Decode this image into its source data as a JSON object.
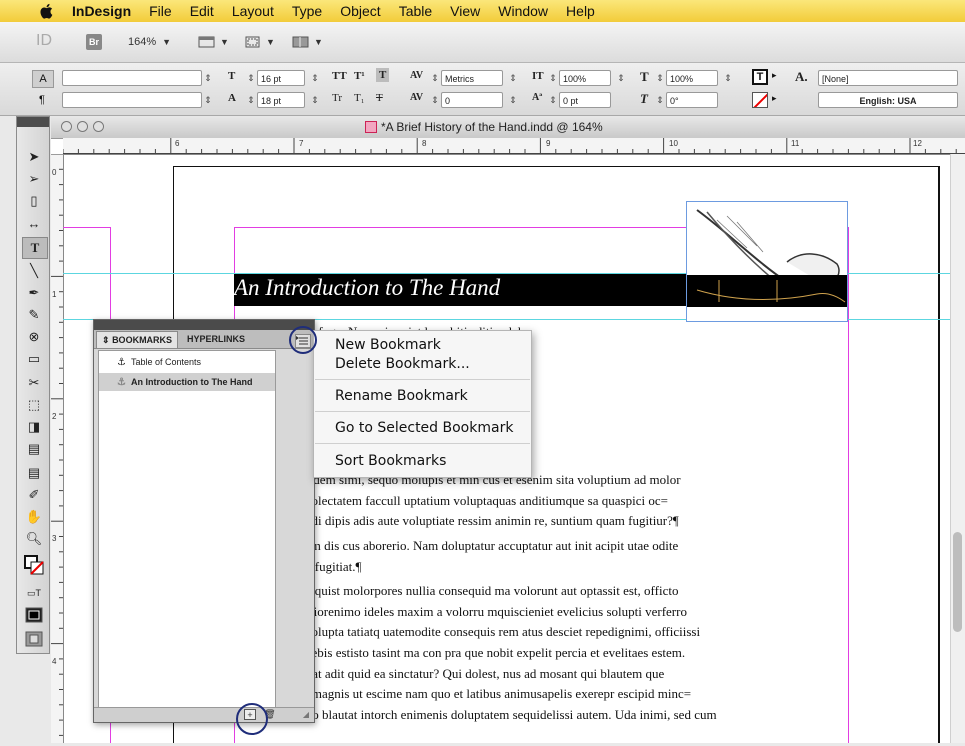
{
  "menubar": {
    "app": "InDesign",
    "items": [
      "File",
      "Edit",
      "Layout",
      "Type",
      "Object",
      "Table",
      "View",
      "Window",
      "Help"
    ]
  },
  "appbar": {
    "logo": "ID",
    "bridge": "Br",
    "zoom": "164%"
  },
  "control": {
    "font_size": "16 pt",
    "leading": "18 pt",
    "kerning": "Metrics",
    "tracking": "0",
    "vscale": "100%",
    "hscale": "100%",
    "baseline": "0 pt",
    "skew": "0°",
    "char_style": "[None]",
    "language": "English: USA",
    "case_buttons": [
      "TT",
      "T¹",
      "T",
      "Tr",
      "T₁",
      "T"
    ]
  },
  "document": {
    "title": "*A Brief History of the Hand.indd @ 164%",
    "ruler_h": [
      "6",
      "7",
      "8",
      "9",
      "10",
      "11",
      "12"
    ],
    "ruler_v": [
      "0",
      "1",
      "2",
      "3",
      "4"
    ],
    "heading": "An Introduction to The Hand",
    "body_lines": [
      "m fuga. Nam, sim niet la nobitis ditiandel",
      "simus delende niscia vitat que nobita que",
      "et ea ipsaecuptur autem aut ipsam aut ea",
      "um niminimpor alia aut labori cus, occum",
      "nentum hicius ut omni alitae si alic tore",
      "nis ad entibustrum ressunt, eum nonseque",
      "r re est, aditatur?¶",
      "s dem simi, sequo molupis et min cus et esenim sita voluptium ad molor",
      " dolectatem faccull uptatium voluptaquas anditiumque sa quaspici oc=",
      " odi dipis adis aute voluptiate ressim animin re, suntium quam fugitiur?¶",
      "em dis cus aborerio. Nam doluptatur accuptatur aut init acipit utae odite",
      "n fugitiat.¶",
      "d quist molorpores nullia consequid ma volorunt aut optassit est, officto",
      "stiorenimo ideles maxim a volorru mquiscieniet evelicius solupti verferro",
      "volupta tatiatq uatemodite consequis rem atus desciet repedignimi, officiissi",
      "debis estisto tasint ma con pra que nobit expelit percia et evelitaes estem.",
      "itat adit quid ea sinctatur? Qui dolest, nus ad mosant qui blautem que",
      "t magnis ut escime nam quo et latibus animusapelis exerepr escipid minc=",
      "tio blautat intorch enimenis doluptatem sequidelissi autem. Uda inimi, sed cum"
    ]
  },
  "bookmarks_panel": {
    "tabs": [
      "BOOKMARKS",
      "HYPERLINKS"
    ],
    "items": [
      "Table of Contents",
      "An Introduction to The Hand"
    ]
  },
  "flyout_menu": {
    "items": [
      "New Bookmark",
      "Delete Bookmark...",
      "Rename Bookmark",
      "Go to Selected Bookmark",
      "Sort Bookmarks"
    ]
  },
  "colors": {
    "menubar": "#f2cc3a",
    "margin_guide": "#e23de2",
    "column_guide": "#5cd6e0",
    "highlight_circle": "#1f2d7a"
  }
}
